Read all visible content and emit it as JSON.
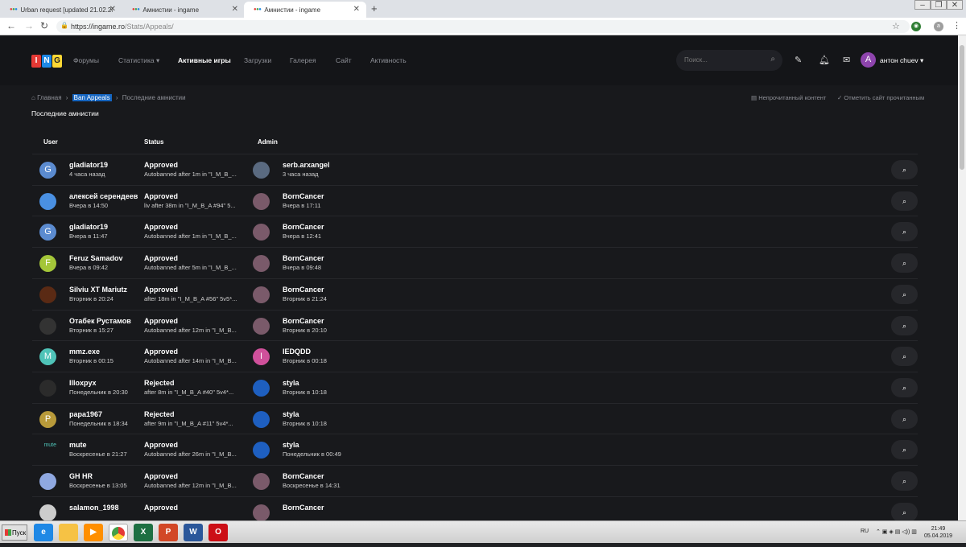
{
  "browser": {
    "tabs": [
      {
        "title": "Urban request [updated 21.02.2019"
      },
      {
        "title": "Амнистии - ingame"
      },
      {
        "title": "Амнистии - ingame"
      }
    ],
    "url_main": "https://ingame.ro",
    "url_path": "/Stats/Appeals/"
  },
  "site": {
    "logo": [
      "I",
      "N",
      "G"
    ],
    "nav": [
      "Форумы",
      "Статистика ▾",
      "Активные игры",
      "Загрузки",
      "Галерея",
      "Сайт",
      "Активность"
    ],
    "search_placeholder": "Поиск...",
    "user_initial": "A",
    "username": "антон chuev ▾",
    "breadcrumb": {
      "home": "Главная",
      "section": "Ban Appeals",
      "current": "Последние амнистии"
    },
    "unread": "Непрочитанный контент",
    "mark_read": "Отметить сайт прочитанным",
    "page_title": "Последние амнистии",
    "columns": {
      "user": "User",
      "status": "Status",
      "admin": "Admin"
    },
    "rows": [
      {
        "user": "gladiator19",
        "time": "4 часа назад",
        "initial": "G",
        "status": "Approved",
        "reason": "Autobanned after 1m in \"I_M_B_...",
        "admin": "serb.arxangel",
        "atime": "3 часа назад",
        "ainitial": ""
      },
      {
        "user": "алексей серендеев",
        "time": "Вчера в 14:50",
        "initial": "",
        "status": "Approved",
        "reason": "liv after 38m in \"I_M_B_A #94\" 5...",
        "admin": "BornCancer",
        "atime": "Вчера в 17:11",
        "ainitial": ""
      },
      {
        "user": "gladiator19",
        "time": "Вчера в 11:47",
        "initial": "G",
        "status": "Approved",
        "reason": "Autobanned after 1m in \"I_M_B_...",
        "admin": "BornCancer",
        "atime": "Вчера в 12:41",
        "ainitial": ""
      },
      {
        "user": "Feruz Samadov",
        "time": "Вчера в 09:42",
        "initial": "F",
        "status": "Approved",
        "reason": "Autobanned after 5m in \"I_M_B_...",
        "admin": "BornCancer",
        "atime": "Вчера в 09:48",
        "ainitial": ""
      },
      {
        "user": "Silviu XT Mariutz",
        "time": "Вторник в 20:24",
        "initial": "",
        "status": "Approved",
        "reason": "after 18m in \"I_M_B_A #56\" 5v5*...",
        "admin": "BornCancer",
        "atime": "Вторник в 21:24",
        "ainitial": ""
      },
      {
        "user": "Отабек Рустамов",
        "time": "Вторник в 15:27",
        "initial": "",
        "status": "Approved",
        "reason": "Autobanned after 12m in \"I_M_B...",
        "admin": "BornCancer",
        "atime": "Вторник в 20:10",
        "ainitial": ""
      },
      {
        "user": "mmz.exe",
        "time": "Вторник в 00:15",
        "initial": "M",
        "status": "Approved",
        "reason": "Autobanned after 14m in \"I_M_B...",
        "admin": "IEDQDD",
        "atime": "Вторник в 00:18",
        "ainitial": "I"
      },
      {
        "user": "Illoxpyx",
        "time": "Понедельник в 20:30",
        "initial": "",
        "status": "Rejected",
        "reason": "after 8m in \"I_M_B_A #40\" 5v4*...",
        "admin": "styla",
        "atime": "Вторник в 10:18",
        "ainitial": ""
      },
      {
        "user": "papa1967",
        "time": "Понедельник в 18:34",
        "initial": "P",
        "status": "Rejected",
        "reason": "after 9m in \"I_M_B_A #11\" 5v4*...",
        "admin": "styla",
        "atime": "Вторник в 10:18",
        "ainitial": ""
      },
      {
        "user": "mute",
        "time": "Воскресенье в 21:27",
        "initial": "mute",
        "status": "Approved",
        "reason": "Autobanned after 26m in \"I_M_B...",
        "admin": "styla",
        "atime": "Понедельник в 00:49",
        "ainitial": ""
      },
      {
        "user": "GH HR",
        "time": "Воскресенье в 13:05",
        "initial": "",
        "status": "Approved",
        "reason": "Autobanned after 12m in \"I_M_B...",
        "admin": "BornCancer",
        "atime": "Воскресенье в 14:31",
        "ainitial": ""
      },
      {
        "user": "salamon_1998",
        "time": "",
        "initial": "",
        "status": "Approved",
        "reason": "",
        "admin": "BornCancer",
        "atime": "",
        "ainitial": ""
      }
    ],
    "colors": {
      "avatar": [
        "#5b8bd0",
        "#4a90e2",
        "#5b8bd0",
        "#a4c639",
        "#5a2a14",
        "#333333",
        "#4fc3b8",
        "#2b2b2b",
        "#b89a3a",
        "#18191c",
        "#8fa8e0",
        "#cccccc"
      ],
      "admin_avatar": [
        "#5a6a80",
        "#7a5a6a",
        "#7a5a6a",
        "#7a5a6a",
        "#7a5a6a",
        "#7a5a6a",
        "#d0509b",
        "#1e5fc0",
        "#1e5fc0",
        "#1e5fc0",
        "#7a5a6a",
        "#7a5a6a"
      ]
    }
  },
  "taskbar": {
    "start": "Пуск",
    "apps": [
      "e",
      "",
      "",
      "",
      "X",
      "P",
      "W",
      "O"
    ],
    "lang": "RU",
    "time": "21:49",
    "date": "05.04.2019"
  }
}
